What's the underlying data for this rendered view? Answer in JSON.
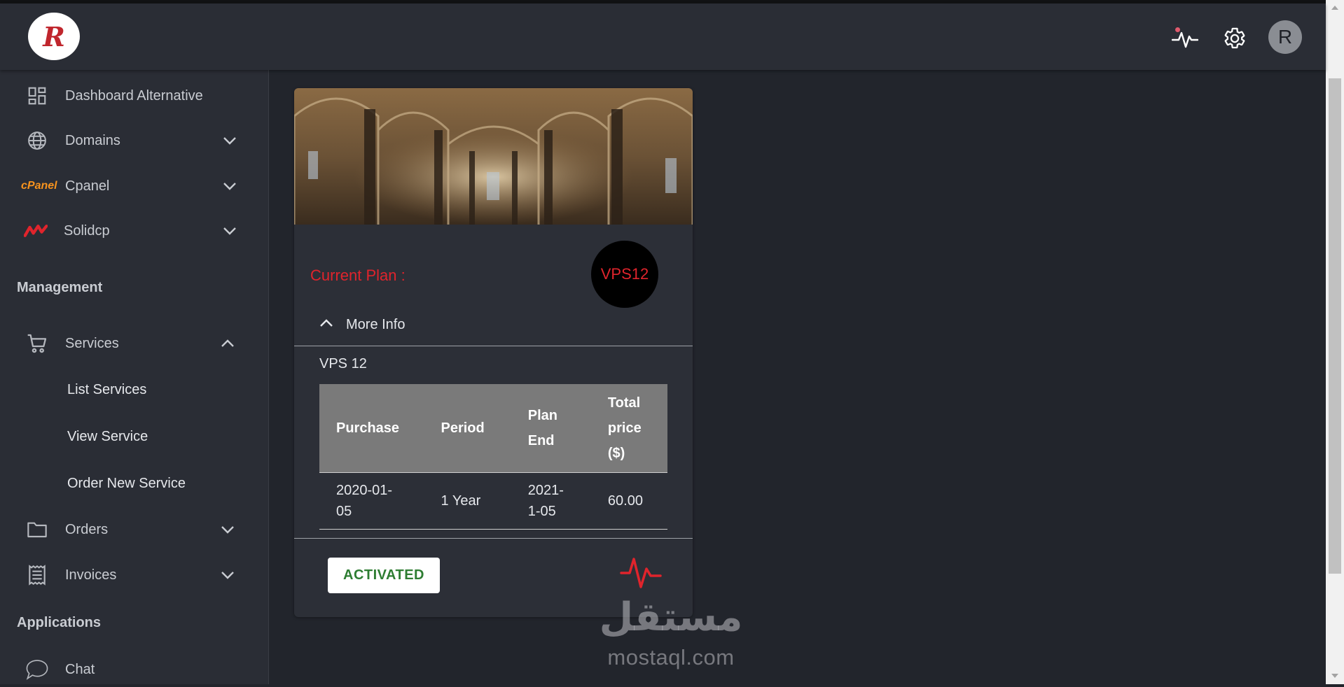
{
  "app": {
    "logo_letter": "R",
    "brand_color": "#c0262d",
    "accent_red": "#e0242c"
  },
  "header": {
    "icons": [
      "activity-icon",
      "gear-icon"
    ],
    "avatar_letter": "R"
  },
  "sidebar": {
    "items": [
      {
        "label": "Dashboard Alternative",
        "icon": "dashboard-icon"
      },
      {
        "label": "Domains",
        "icon": "globe-icon"
      },
      {
        "label": "Cpanel",
        "icon": "cpanel-logo"
      },
      {
        "label": "Solidcp",
        "icon": "solidcp-logo"
      }
    ],
    "sections": {
      "management": "Management",
      "applications": "Applications"
    },
    "management_items": [
      {
        "label": "Services",
        "icon": "cart-icon",
        "expanded": true
      },
      {
        "label": "Orders",
        "icon": "folder-icon"
      },
      {
        "label": "Invoices",
        "icon": "receipt-icon"
      }
    ],
    "services_subitems": [
      "List Services",
      "View Service",
      "Order New Service"
    ],
    "application_items": [
      {
        "label": "Chat",
        "icon": "chat-icon"
      }
    ],
    "cpanel_logo_text": "cPanel"
  },
  "card": {
    "current_plan_label": "Current Plan :",
    "plan_badge": "VPS12",
    "more_info_label": "More Info",
    "plan_name": "VPS 12",
    "table": {
      "headers": [
        "Purchase",
        "Period",
        "Plan End",
        "Total price ($)"
      ],
      "rows": [
        [
          "2020-01-05",
          "1 Year",
          "2021-1-05",
          "60.00"
        ]
      ]
    },
    "status": "ACTIVATED",
    "status_color": "#2e7d32"
  },
  "watermark": {
    "arabic": "مستقل",
    "latin": "mostaql.com"
  }
}
